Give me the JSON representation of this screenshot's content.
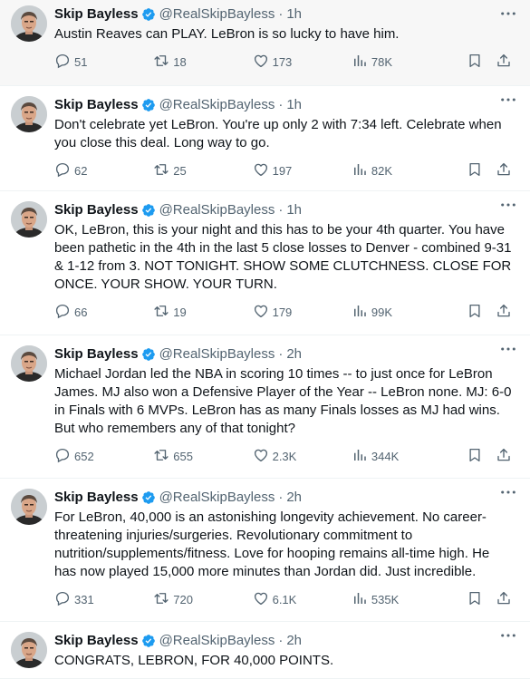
{
  "colors": {
    "text": "#0f1419",
    "muted": "#536471",
    "verified": "#1d9bf0",
    "divider": "#eff3f4",
    "hover_bg": "#f7f7f7"
  },
  "tweets": [
    {
      "name": "Skip Bayless",
      "handle": "@RealSkipBayless",
      "dot": "·",
      "time": "1h",
      "text": "Austin Reaves can PLAY. LeBron is so lucky to have him.",
      "replies": "51",
      "retweets": "18",
      "likes": "173",
      "views": "78K"
    },
    {
      "name": "Skip Bayless",
      "handle": "@RealSkipBayless",
      "dot": "·",
      "time": "1h",
      "text": "Don't celebrate yet LeBron. You're up only 2 with 7:34 left. Celebrate when you close this deal. Long way to go.",
      "replies": "62",
      "retweets": "25",
      "likes": "197",
      "views": "82K"
    },
    {
      "name": "Skip Bayless",
      "handle": "@RealSkipBayless",
      "dot": "·",
      "time": "1h",
      "text": "OK, LeBron, this is your night and this has to be your 4th quarter. You have been pathetic in the 4th in the last 5 close losses to Denver - combined 9-31 & 1-12 from 3. NOT TONIGHT. SHOW SOME CLUTCHNESS. CLOSE FOR ONCE. YOUR SHOW. YOUR TURN.",
      "replies": "66",
      "retweets": "19",
      "likes": "179",
      "views": "99K"
    },
    {
      "name": "Skip Bayless",
      "handle": "@RealSkipBayless",
      "dot": "·",
      "time": "2h",
      "text": "Michael Jordan led the NBA in scoring 10 times -- to just once for LeBron James. MJ also won a Defensive Player of the Year -- LeBron none. MJ: 6-0 in Finals with 6 MVPs. LeBron has as many Finals losses as MJ had wins. But who remembers any of that tonight?",
      "replies": "652",
      "retweets": "655",
      "likes": "2.3K",
      "views": "344K"
    },
    {
      "name": "Skip Bayless",
      "handle": "@RealSkipBayless",
      "dot": "·",
      "time": "2h",
      "text": "For LeBron, 40,000 is an astonishing longevity achievement. No career-threatening injuries/surgeries. Revolutionary commitment to nutrition/supplements/fitness. Love for hooping remains all-time high. He has now played 15,000 more minutes than Jordan did. Just incredible.",
      "replies": "331",
      "retweets": "720",
      "likes": "6.1K",
      "views": "535K"
    },
    {
      "name": "Skip Bayless",
      "handle": "@RealSkipBayless",
      "dot": "·",
      "time": "2h",
      "text": "CONGRATS, LEBRON, FOR 40,000 POINTS.",
      "replies": "",
      "retweets": "",
      "likes": "",
      "views": ""
    }
  ]
}
